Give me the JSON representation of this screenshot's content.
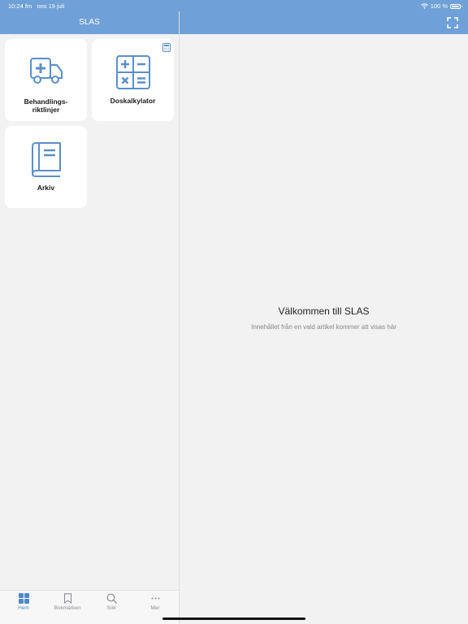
{
  "status": {
    "time": "10:24 fm",
    "date": "ons 19 juli",
    "battery": "100 %",
    "battery_level": 1.0
  },
  "nav": {
    "title": "SLAS",
    "expand_icon": "expand-icon"
  },
  "tiles": [
    {
      "label_line1": "Behandlings-",
      "label_line2": "riktlinjer",
      "icon": "ambulance-icon"
    },
    {
      "label_line1": "Doskalkylator",
      "icon": "calculator-icon",
      "badge_icon": "small-calculator-icon"
    },
    {
      "label_line1": "Arkiv",
      "icon": "book-icon"
    }
  ],
  "detail": {
    "title": "Välkommen till SLAS",
    "subtitle": "Innehållet från en vald artikel kommer att visas här"
  },
  "tabbar": {
    "items": [
      {
        "label": "Hem",
        "icon": "grid-icon",
        "active": true
      },
      {
        "label": "Bokmärken",
        "icon": "bookmark-icon",
        "active": false
      },
      {
        "label": "Sök",
        "icon": "search-icon",
        "active": false
      },
      {
        "label": "Mer",
        "icon": "more-icon",
        "active": false
      }
    ]
  },
  "colors": {
    "accent": "#6fa0d7",
    "icon": "#5b8fcb",
    "background": "#f2f2f2",
    "tile": "#ffffff"
  }
}
